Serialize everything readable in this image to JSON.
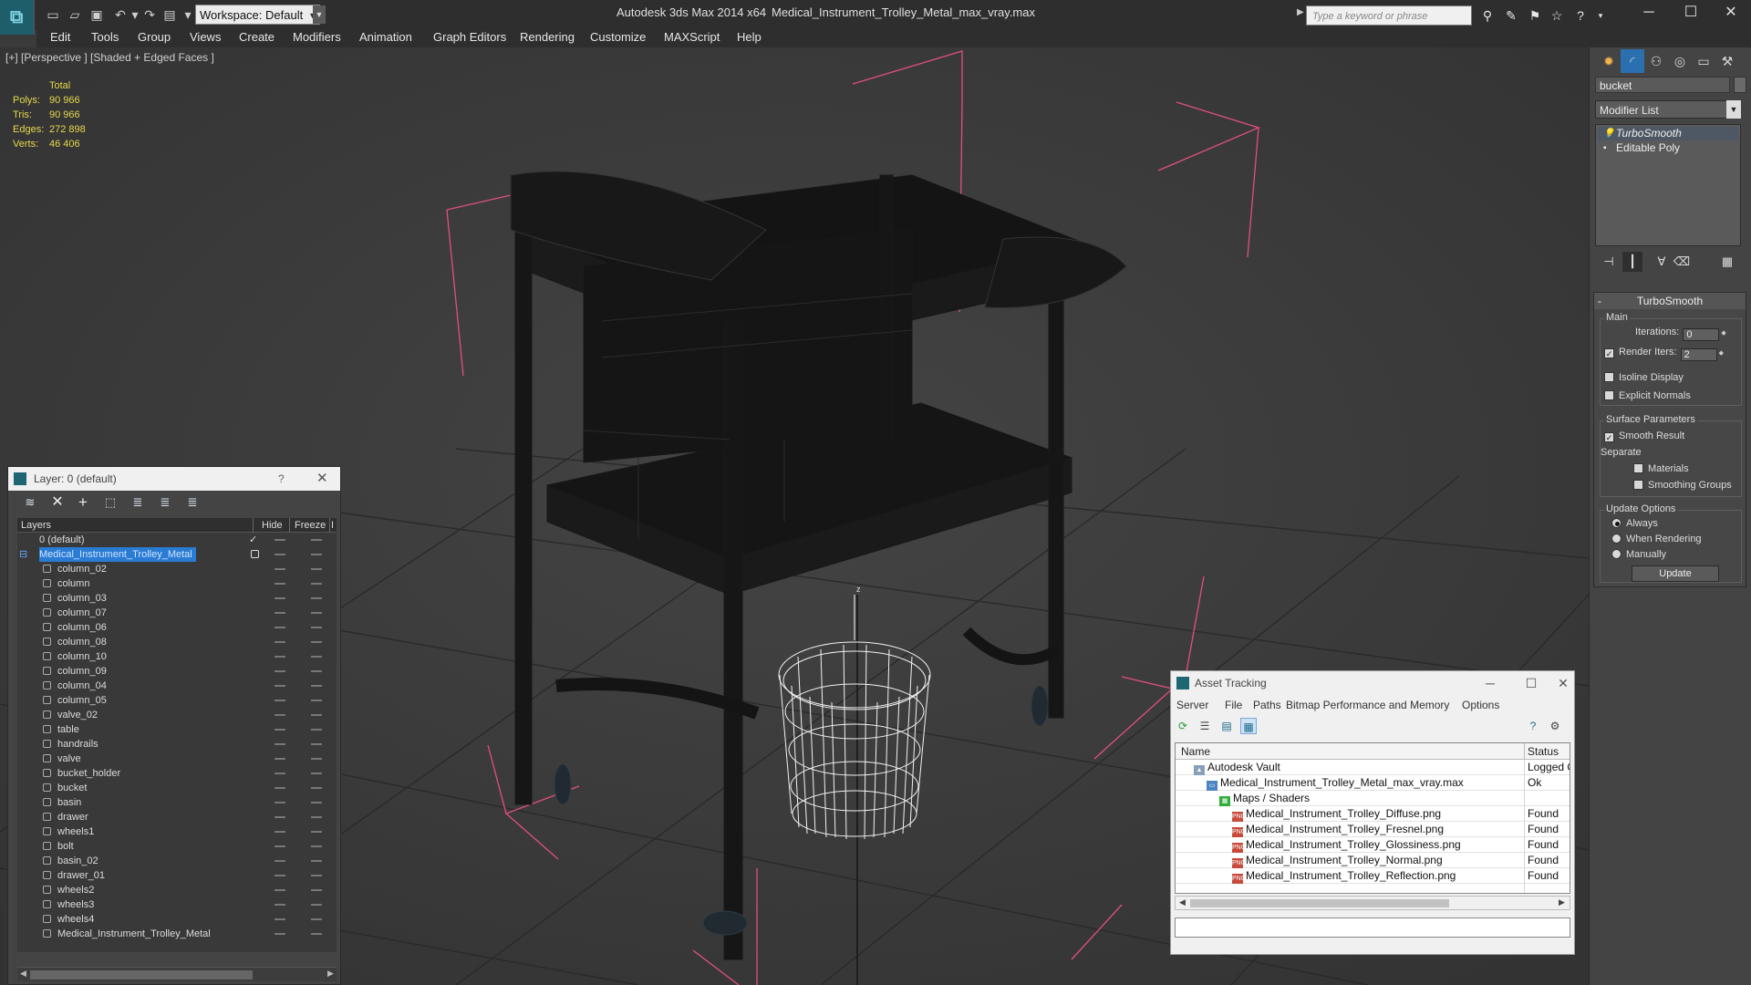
{
  "titlebar": {
    "workspace": "Workspace: Default",
    "app_title": "Autodesk 3ds Max  2014 x64",
    "file_title": "Medical_Instrument_Trolley_Metal_max_vray.max",
    "search_placeholder": "Type a keyword or phrase"
  },
  "menu": [
    "Edit",
    "Tools",
    "Group",
    "Views",
    "Create",
    "Modifiers",
    "Animation",
    "Graph Editors",
    "Rendering",
    "Customize",
    "MAXScript",
    "Help"
  ],
  "viewport": {
    "label": "[+] [Perspective ] [Shaded + Edged Faces ]",
    "stats": {
      "total_label": "Total",
      "rows": [
        {
          "label": "Polys:",
          "value": "90 966"
        },
        {
          "label": "Tris:",
          "value": "90 966"
        },
        {
          "label": "Edges:",
          "value": "272 898"
        },
        {
          "label": "Verts:",
          "value": "46 406"
        }
      ]
    },
    "axis_label": "z"
  },
  "command_panel": {
    "object_name": "bucket",
    "modifier_list": "Modifier List",
    "stack": [
      "TurboSmooth",
      "Editable Poly"
    ],
    "turbosmooth": {
      "title": "TurboSmooth",
      "main": "Main",
      "iterations_label": "Iterations:",
      "iterations_value": "0",
      "render_iters_label": "Render Iters:",
      "render_iters_value": "2",
      "isoline": "Isoline Display",
      "explicit_normals": "Explicit Normals",
      "surface_params": "Surface Parameters",
      "smooth_result": "Smooth Result",
      "separate": "Separate",
      "materials": "Materials",
      "smoothing_groups": "Smoothing Groups",
      "update_options": "Update Options",
      "always": "Always",
      "when_rendering": "When Rendering",
      "manually": "Manually",
      "update_btn": "Update"
    }
  },
  "layer_panel": {
    "title": "Layer: 0 (default)",
    "help": "?",
    "col_layers": "Layers",
    "col_hide": "Hide",
    "col_freeze": "Freeze",
    "col_extra": "I",
    "default_layer": "0 (default)",
    "selected_layer": "Medical_Instrument_Trolley_Metal",
    "objects": [
      "column_02",
      "column",
      "column_03",
      "column_07",
      "column_06",
      "column_08",
      "column_10",
      "column_09",
      "column_04",
      "column_05",
      "valve_02",
      "table",
      "handrails",
      "valve",
      "bucket_holder",
      "bucket",
      "basin",
      "drawer",
      "wheels1",
      "bolt",
      "basin_02",
      "drawer_01",
      "wheels2",
      "wheels3",
      "wheels4",
      "Medical_Instrument_Trolley_Metal"
    ]
  },
  "asset_panel": {
    "title": "Asset Tracking",
    "menu": [
      "Server",
      "File",
      "Paths",
      "Bitmap Performance and Memory",
      "Options"
    ],
    "col_name": "Name",
    "col_status": "Status",
    "rows": [
      {
        "name": "Autodesk Vault",
        "status": "Logged O",
        "indent": 0,
        "icon": "vault"
      },
      {
        "name": "Medical_Instrument_Trolley_Metal_max_vray.max",
        "status": "Ok",
        "indent": 1,
        "icon": "max"
      },
      {
        "name": "Maps / Shaders",
        "status": "",
        "indent": 2,
        "icon": "maps"
      },
      {
        "name": "Medical_Instrument_Trolley_Diffuse.png",
        "status": "Found",
        "indent": 3,
        "icon": "png"
      },
      {
        "name": "Medical_Instrument_Trolley_Fresnel.png",
        "status": "Found",
        "indent": 3,
        "icon": "png"
      },
      {
        "name": "Medical_Instrument_Trolley_Glossiness.png",
        "status": "Found",
        "indent": 3,
        "icon": "png"
      },
      {
        "name": "Medical_Instrument_Trolley_Normal.png",
        "status": "Found",
        "indent": 3,
        "icon": "png"
      },
      {
        "name": "Medical_Instrument_Trolley_Reflection.png",
        "status": "Found",
        "indent": 3,
        "icon": "png"
      }
    ]
  },
  "colors": {
    "stats_text": "#e6d84a",
    "selection": "#2a7bd4",
    "bbox_lines": "#e0507a"
  }
}
